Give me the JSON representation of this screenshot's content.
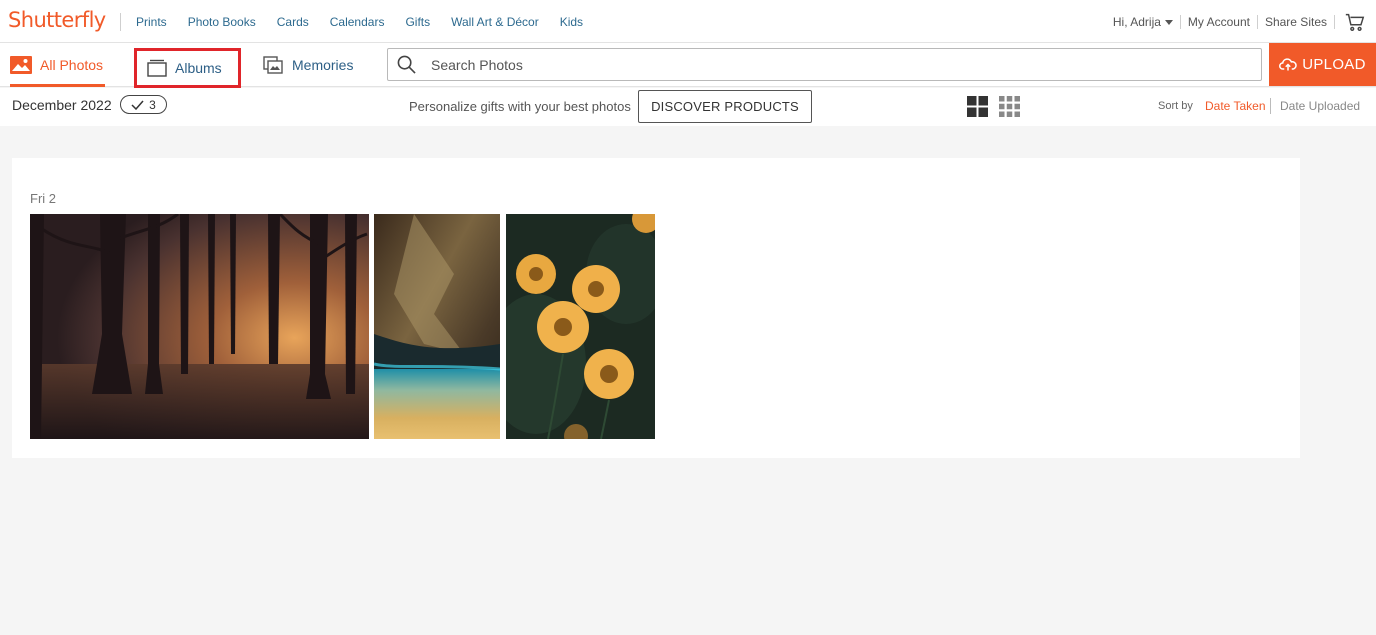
{
  "brand": {
    "logo_text": "Shutterfly",
    "accent": "#f15a29"
  },
  "nav": {
    "links": [
      "Prints",
      "Photo Books",
      "Cards",
      "Calendars",
      "Gifts",
      "Wall Art & Décor",
      "Kids"
    ],
    "greeting": "Hi, Adrija",
    "account": "My Account",
    "share_sites": "Share Sites"
  },
  "tabs": {
    "all_photos": "All Photos",
    "albums": "Albums",
    "memories": "Memories"
  },
  "search": {
    "placeholder": "Search Photos"
  },
  "upload": {
    "label": "UPLOAD"
  },
  "subbar": {
    "month": "December 2022",
    "count": "3",
    "promo": "Personalize gifts with your best photos",
    "discover": "DISCOVER PRODUCTS",
    "sort_by": "Sort by",
    "sort_active": "Date Taken",
    "sort_other": "Date Uploaded"
  },
  "content": {
    "day_label": "Fri 2",
    "photos": [
      {
        "subject": "misty forest trees at sunset"
      },
      {
        "subject": "cave with turquoise water"
      },
      {
        "subject": "yellow flowers on dark green"
      }
    ]
  },
  "icons": {
    "all_photos": "image-icon",
    "albums": "album-icon",
    "memories": "memories-icon",
    "search": "search-icon",
    "upload": "cloud-upload-icon",
    "cart": "cart-icon",
    "check": "check-icon",
    "grid_large": "grid-large-icon",
    "grid_small": "grid-small-icon"
  }
}
